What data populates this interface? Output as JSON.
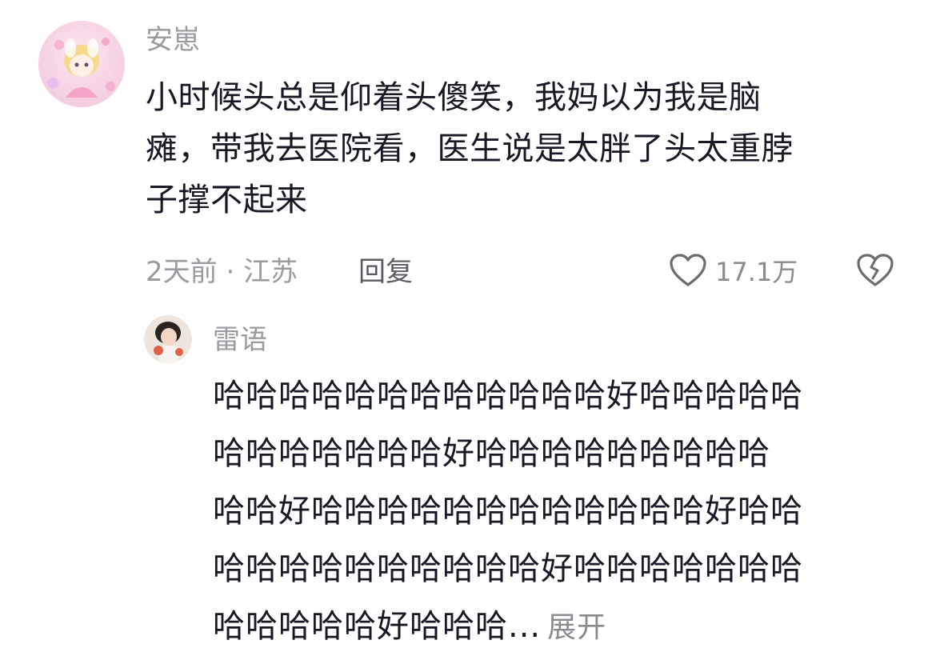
{
  "comment": {
    "username": "安崽",
    "text_lines": [
      "小时候头总是仰着头傻笑，我妈以为我是脑",
      "瘫，带我去医院看，医生说是太胖了头太重脖",
      "子撑不起来"
    ],
    "time": "2天前",
    "separator": "·",
    "location": "江苏",
    "reply_label": "回复",
    "like_count": "17.1万",
    "like_icon": "heart-outline-icon",
    "dislike_icon": "broken-heart-icon"
  },
  "reply": {
    "username": "雷语",
    "text_lines": [
      "哈哈哈哈哈哈哈哈哈哈哈哈好哈哈哈哈哈",
      "哈哈哈哈哈哈哈好哈哈哈哈哈哈哈哈哈",
      "哈哈好哈哈哈哈哈哈哈哈哈哈哈哈好哈哈",
      "哈哈哈哈哈哈哈哈哈哈好哈哈哈哈哈哈哈",
      "哈哈哈哈哈好哈哈哈..."
    ],
    "expand_label": "展开"
  },
  "colors": {
    "text_primary": "#161823",
    "text_secondary": "#9a9aa0",
    "reply_button": "#5a5b63",
    "icon_stroke": "#6b6c73"
  }
}
